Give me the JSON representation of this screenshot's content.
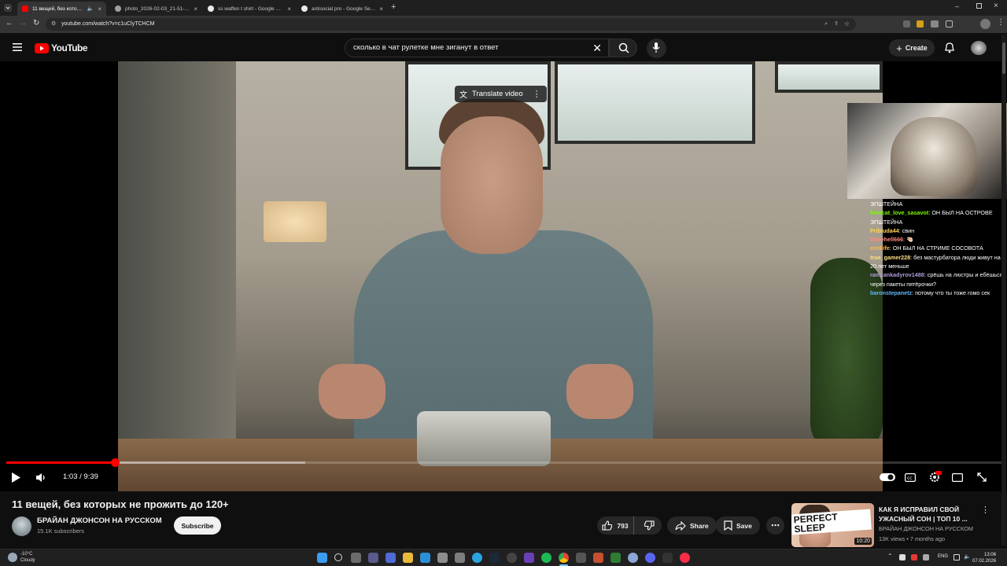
{
  "browser": {
    "tabs": [
      {
        "title": "11 вещей, без которых не",
        "favicon_color": "#ff0000",
        "active": true
      },
      {
        "title": "photo_2026-02-03_21-51-50.jpg",
        "favicon_color": "#9aa0a6",
        "active": false
      },
      {
        "title": "ss waffen t shirt - Google Search",
        "favicon_color": "#e8eaed",
        "active": false
      },
      {
        "title": "antisocial pro - Google Search",
        "favicon_color": "#e8eaed",
        "active": false
      }
    ],
    "url": "youtube.com/watch?v=c1uClyTCHCM"
  },
  "yt_header": {
    "logo_text": "YouTube",
    "search_value": "сколько в чат рулетке мне зиганут в ответ",
    "create_label": "Create"
  },
  "player": {
    "translate_label": "Translate video",
    "time_current": "1:03",
    "time_total": "9:39",
    "time_display": "1:03 / 9:39",
    "played_fraction": 0.109,
    "buffered_fraction": 0.3
  },
  "overlay_chat": [
    {
      "user": "",
      "text": "ЭПШТЕЙНА",
      "color": "#ffffff"
    },
    {
      "user": "himicat_love_sasavot",
      "text": "ОН БЫЛ НА ОСТРОВЕ ЭПШТЕЙНА",
      "color": "#7cfc00"
    },
    {
      "user": "Pribluda44",
      "text": "свин",
      "color": "#ffd54f"
    },
    {
      "user": "threehell666",
      "text": "🤏🏻",
      "color": "#ff8a80"
    },
    {
      "user": "em0life",
      "text": "ОН БЫЛ НА СТРИМЕ СОСОВОТА",
      "color": "#ffb74d"
    },
    {
      "user": "true_gamer228",
      "text": "без мастурбатора люди живут на 20 лет меньше",
      "color": "#ffe082"
    },
    {
      "user": "ramzankadyrov1488",
      "text": "срёшь на люстры и ебёшься через пакеты пятёрочки?",
      "color": "#b39ddb"
    },
    {
      "user": "baronstepanetz",
      "text": "потому что ты тоже гомо сек",
      "color": "#64b5f6"
    }
  ],
  "video": {
    "title": "11 вещей, без которых не прожить до 120+",
    "channel": "БРАЙАН ДЖОНСОН НА РУССКОМ",
    "subscribers": "15.1K subscribers",
    "subscribe_label": "Subscribe",
    "likes": "793",
    "share_label": "Share",
    "save_label": "Save"
  },
  "suggestion": {
    "title": "КАК Я ИСПРАВИЛ СВОЙ УЖАСНЫЙ СОН | ТОП 10 ...",
    "channel": "БРАЙАН ДЖОНСОН НА РУССКОМ",
    "meta": "13K views • 7 months ago",
    "duration": "10:20",
    "thumb_text": "PERFECT SLEEP"
  },
  "taskbar": {
    "temperature": "-10°C",
    "weather": "Cloudy",
    "lang": "ENG",
    "time": "13:06",
    "date": "07.02.2026"
  },
  "colors": {
    "yt_red": "#ff0000",
    "bg": "#0f0f0f",
    "pill": "#272727"
  }
}
